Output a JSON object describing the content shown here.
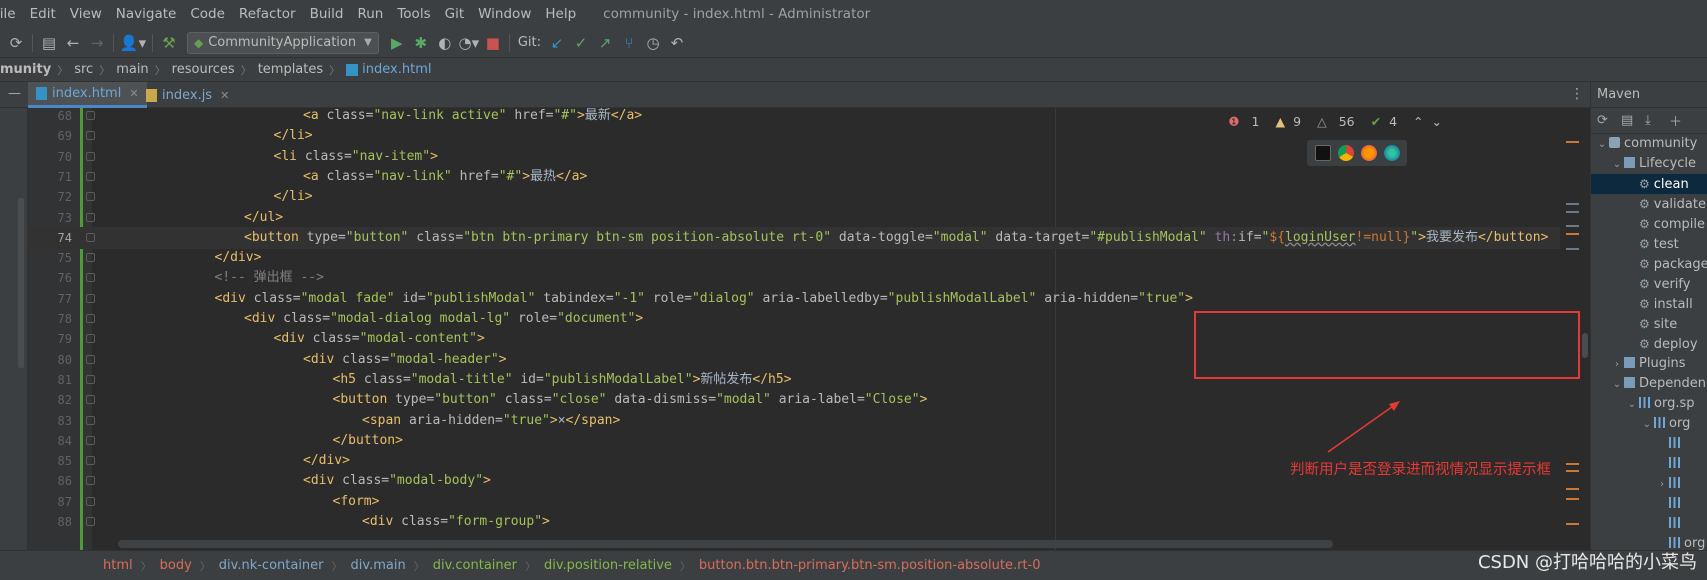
{
  "menubar": {
    "items": [
      "File",
      "Edit",
      "View",
      "Navigate",
      "Code",
      "Refactor",
      "Build",
      "Run",
      "Tools",
      "Git",
      "Window",
      "Help"
    ],
    "window_title": "community - index.html - Administrator"
  },
  "toolbar": {
    "run_config": "CommunityApplication",
    "git_label": "Git:"
  },
  "navbar": {
    "crumbs": [
      "munity",
      "src",
      "main",
      "resources",
      "templates",
      "index.html"
    ]
  },
  "tabs": [
    {
      "label": "index.html",
      "active": true
    },
    {
      "label": "index.js",
      "active": false
    }
  ],
  "inspection": {
    "errors": "1",
    "warnings": "9",
    "weak_warnings": "56",
    "ok": "4"
  },
  "editor": {
    "lines": [
      {
        "num": "68",
        "indent": 6,
        "html": "<span class='tag'>&lt;a</span> <span class='attr'>class=</span><span class='str'>\"nav-link active\"</span> <span class='attr'>href=</span><span class='str'>\"#\"</span><span class='tag'>&gt;</span>最新<span class='tag'>&lt;/a&gt;</span>"
      },
      {
        "num": "69",
        "indent": 5,
        "html": "<span class='tag'>&lt;/li&gt;</span>"
      },
      {
        "num": "70",
        "indent": 5,
        "html": "<span class='tag'>&lt;li</span> <span class='attr'>class=</span><span class='str'>\"nav-item\"</span><span class='tag'>&gt;</span>"
      },
      {
        "num": "71",
        "indent": 6,
        "html": "<span class='tag'>&lt;a</span> <span class='attr'>class=</span><span class='str'>\"nav-link\"</span> <span class='attr'>href=</span><span class='str'>\"#\"</span><span class='tag'>&gt;</span>最热<span class='tag'>&lt;/a&gt;</span>"
      },
      {
        "num": "72",
        "indent": 5,
        "html": "<span class='tag'>&lt;/li&gt;</span>"
      },
      {
        "num": "73",
        "indent": 4,
        "html": "<span class='tag'>&lt;/ul&gt;</span>"
      },
      {
        "num": "74",
        "indent": 4,
        "current": true,
        "html": "<span class='tag'>&lt;button</span> <span class='attr'>type=</span><span class='str'>\"button\"</span> <span class='attr'>class=</span><span class='str'>\"btn btn-primary btn-sm position-absolute rt-0\"</span> <span class='attr'>data-toggle=</span><span class='str'>\"modal\"</span> <span class='attr'>data-target=</span><span class='str'>\"#publishModal\"</span> <span class='th-attr'>th:</span><span class='attr'>if=</span><span class='str'>\"</span><span class='expr'>${</span><span class='hl-user'>loginUser</span><span class='expr'>!=null}</span><span class='str'>\"</span><span class='tag'>&gt;</span>我要发布<span class='tag'>&lt;/button&gt;</span>"
      },
      {
        "num": "75",
        "indent": 3,
        "html": "<span class='tag'>&lt;/div&gt;</span>"
      },
      {
        "num": "76",
        "indent": 3,
        "html": "<span class='comment'>&lt;!-- 弹出框 --&gt;</span>"
      },
      {
        "num": "77",
        "indent": 3,
        "html": "<span class='tag'>&lt;div</span> <span class='attr'>class=</span><span class='str'>\"modal fade\"</span> <span class='attr'>id=</span><span class='str'>\"publishModal\"</span> <span class='attr'>tabindex=</span><span class='str'>\"-1\"</span> <span class='attr'>role=</span><span class='str'>\"dialog\"</span> <span class='attr'>aria-labelledby=</span><span class='str'>\"publishModalLabel\"</span> <span class='attr'>aria-hidden=</span><span class='str'>\"true\"</span><span class='tag'>&gt;</span>"
      },
      {
        "num": "78",
        "indent": 4,
        "html": "<span class='tag'>&lt;div</span> <span class='attr'>class=</span><span class='str'>\"modal-dialog modal-lg\"</span> <span class='attr'>role=</span><span class='str'>\"document\"</span><span class='tag'>&gt;</span>"
      },
      {
        "num": "79",
        "indent": 5,
        "html": "<span class='tag'>&lt;div</span> <span class='attr'>class=</span><span class='str'>\"modal-content\"</span><span class='tag'>&gt;</span>"
      },
      {
        "num": "80",
        "indent": 6,
        "html": "<span class='tag'>&lt;div</span> <span class='attr'>class=</span><span class='str'>\"modal-header\"</span><span class='tag'>&gt;</span>"
      },
      {
        "num": "81",
        "indent": 7,
        "html": "<span class='tag'>&lt;h5</span> <span class='attr'>class=</span><span class='str'>\"modal-title\"</span> <span class='attr'>id=</span><span class='str'>\"publishModalLabel\"</span><span class='tag'>&gt;</span>新帖发布<span class='tag'>&lt;/h5&gt;</span>"
      },
      {
        "num": "82",
        "indent": 7,
        "html": "<span class='tag'>&lt;button</span> <span class='attr'>type=</span><span class='str'>\"button\"</span> <span class='attr'>class=</span><span class='str'>\"close\"</span> <span class='attr'>data-dismiss=</span><span class='str'>\"modal\"</span> <span class='attr'>aria-label=</span><span class='str'>\"Close\"</span><span class='tag'>&gt;</span>"
      },
      {
        "num": "83",
        "indent": 8,
        "html": "<span class='tag'>&lt;span</span> <span class='attr'>aria-hidden=</span><span class='str'>\"true\"</span><span class='tag'>&gt;</span>×<span class='tag'>&lt;/span&gt;</span>"
      },
      {
        "num": "84",
        "indent": 7,
        "html": "<span class='tag'>&lt;/button&gt;</span>"
      },
      {
        "num": "85",
        "indent": 6,
        "html": "<span class='tag'>&lt;/div&gt;</span>"
      },
      {
        "num": "86",
        "indent": 6,
        "html": "<span class='tag'>&lt;div</span> <span class='attr'>class=</span><span class='str'>\"modal-body\"</span><span class='tag'>&gt;</span>"
      },
      {
        "num": "87",
        "indent": 7,
        "html": "<span class='tag'>&lt;form&gt;</span>"
      },
      {
        "num": "88",
        "indent": 8,
        "html": "<span class='tag'>&lt;div</span> <span class='attr'>class=</span><span class='str'>\"form-group\"</span><span class='tag'>&gt;</span>"
      }
    ]
  },
  "annotation": {
    "text": "判断用户是否登录进而视情况显示提示框",
    "color": "#e53935"
  },
  "maven": {
    "title": "Maven",
    "tree": [
      {
        "label": "community",
        "depth": 0,
        "arrow": "down",
        "icon": "maven-project-icon"
      },
      {
        "label": "Lifecycle",
        "depth": 1,
        "arrow": "down",
        "icon": "folder-icon"
      },
      {
        "label": "clean",
        "depth": 2,
        "icon": "gear-icon",
        "selected": true
      },
      {
        "label": "validate",
        "depth": 2,
        "icon": "gear-icon"
      },
      {
        "label": "compile",
        "depth": 2,
        "icon": "gear-icon"
      },
      {
        "label": "test",
        "depth": 2,
        "icon": "gear-icon"
      },
      {
        "label": "package",
        "depth": 2,
        "icon": "gear-icon"
      },
      {
        "label": "verify",
        "depth": 2,
        "icon": "gear-icon"
      },
      {
        "label": "install",
        "depth": 2,
        "icon": "gear-icon"
      },
      {
        "label": "site",
        "depth": 2,
        "icon": "gear-icon"
      },
      {
        "label": "deploy",
        "depth": 2,
        "icon": "gear-icon"
      },
      {
        "label": "Plugins",
        "depth": 1,
        "arrow": "right",
        "icon": "folder-icon"
      },
      {
        "label": "Dependencies",
        "depth": 1,
        "arrow": "down",
        "icon": "folder-icon"
      },
      {
        "label": "org.sp",
        "depth": 2,
        "arrow": "down",
        "icon": "library-icon"
      },
      {
        "label": "org",
        "depth": 3,
        "arrow": "down",
        "icon": "library-icon"
      },
      {
        "label": "",
        "depth": 4,
        "icon": "library-icon"
      },
      {
        "label": "",
        "depth": 4,
        "icon": "library-icon"
      },
      {
        "label": "",
        "depth": 4,
        "arrow": "right",
        "icon": "library-icon"
      },
      {
        "label": "",
        "depth": 4,
        "icon": "library-icon"
      },
      {
        "label": "",
        "depth": 4,
        "icon": "library-icon"
      },
      {
        "label": "org",
        "depth": 4,
        "icon": "library-icon"
      }
    ]
  },
  "statusbar": {
    "crumbs": [
      {
        "label": "html",
        "cls": "c-html"
      },
      {
        "label": "body",
        "cls": "c-body"
      },
      {
        "label": "div.nk-container",
        "cls": "c-div"
      },
      {
        "label": "div.main",
        "cls": "c-main"
      },
      {
        "label": "div.container",
        "cls": "c-cont"
      },
      {
        "label": "div.position-relative",
        "cls": "c-pos"
      },
      {
        "label": "button.btn.btn-primary.btn-sm.position-absolute.rt-0",
        "cls": "c-btn"
      }
    ]
  },
  "watermark": "CSDN @打哈哈哈的小菜鸟"
}
